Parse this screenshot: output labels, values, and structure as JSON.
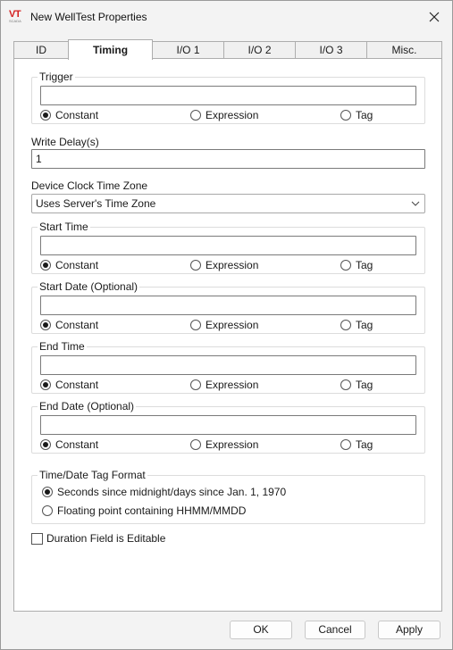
{
  "window": {
    "title": "New WellTest Properties",
    "logo_text": "VT",
    "logo_sub": "SCADA"
  },
  "tabs": [
    {
      "label": "ID",
      "active": false
    },
    {
      "label": "Timing",
      "active": true
    },
    {
      "label": "I/O 1",
      "active": false
    },
    {
      "label": "I/O 2",
      "active": false
    },
    {
      "label": "I/O 3",
      "active": false
    },
    {
      "label": "Misc.",
      "active": false
    }
  ],
  "trigger": {
    "label": "Trigger",
    "value": "",
    "options": [
      "Constant",
      "Expression",
      "Tag"
    ],
    "selected": "Constant"
  },
  "write_delay": {
    "label": "Write Delay(s)",
    "value": "1"
  },
  "time_zone": {
    "label": "Device Clock Time Zone",
    "value": "Uses Server's Time Zone"
  },
  "start_time": {
    "label": "Start Time",
    "value": "",
    "options": [
      "Constant",
      "Expression",
      "Tag"
    ],
    "selected": "Constant"
  },
  "start_date": {
    "label": "Start Date (Optional)",
    "value": "",
    "options": [
      "Constant",
      "Expression",
      "Tag"
    ],
    "selected": "Constant"
  },
  "end_time": {
    "label": "End Time",
    "value": "",
    "options": [
      "Constant",
      "Expression",
      "Tag"
    ],
    "selected": "Constant"
  },
  "end_date": {
    "label": "End Date (Optional)",
    "value": "",
    "options": [
      "Constant",
      "Expression",
      "Tag"
    ],
    "selected": "Constant"
  },
  "tag_format": {
    "label": "Time/Date Tag Format",
    "options": [
      "Seconds since midnight/days since Jan. 1, 1970",
      "Floating point containing HHMM/MMDD"
    ],
    "selected": "Seconds since midnight/days since Jan. 1, 1970"
  },
  "duration_editable": {
    "label": "Duration Field is Editable",
    "checked": false
  },
  "buttons": {
    "ok": "OK",
    "cancel": "Cancel",
    "apply": "Apply"
  },
  "icons": {
    "close": "close-icon",
    "dropdown": "chevron-down-icon"
  }
}
